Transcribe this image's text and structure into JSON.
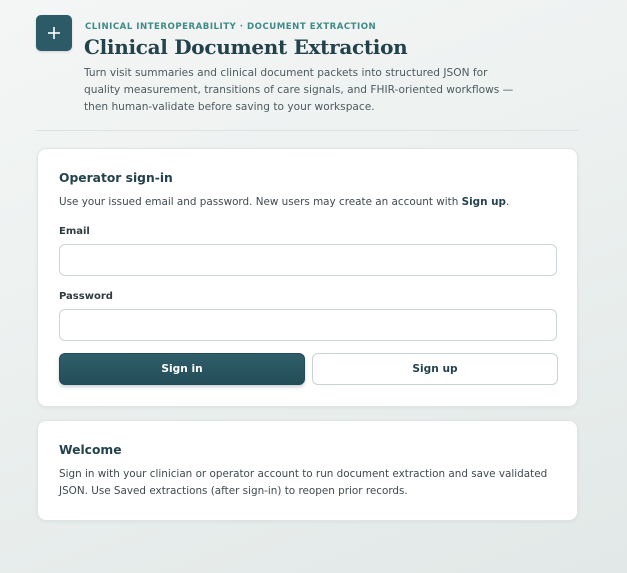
{
  "header": {
    "logo_icon": "plus-icon",
    "eyebrow": "CLINICAL INTEROPERABILITY · DOCUMENT EXTRACTION",
    "title": "Clinical Document Extraction",
    "subtitle": "Turn visit summaries and clinical document packets into structured JSON for quality measurement, transitions of care signals, and FHIR-oriented workflows — then human-validate before saving to your workspace."
  },
  "signin": {
    "heading": "Operator sign-in",
    "lead_prefix": "Use your issued email and password. New users may create an account with ",
    "lead_emphasis": "Sign up",
    "lead_suffix": ".",
    "email_label": "Email",
    "email_value": "",
    "password_label": "Password",
    "password_value": "",
    "signin_button": "Sign in",
    "signup_button": "Sign up"
  },
  "welcome": {
    "heading": "Welcome",
    "text": "Sign in with your clinician or operator account to run document extraction and save validated JSON. Use Saved extractions (after sign-in) to reopen prior records."
  },
  "colors": {
    "accent": "#2c5a66",
    "eyebrow": "#3f8a86",
    "heading": "#23424c"
  }
}
